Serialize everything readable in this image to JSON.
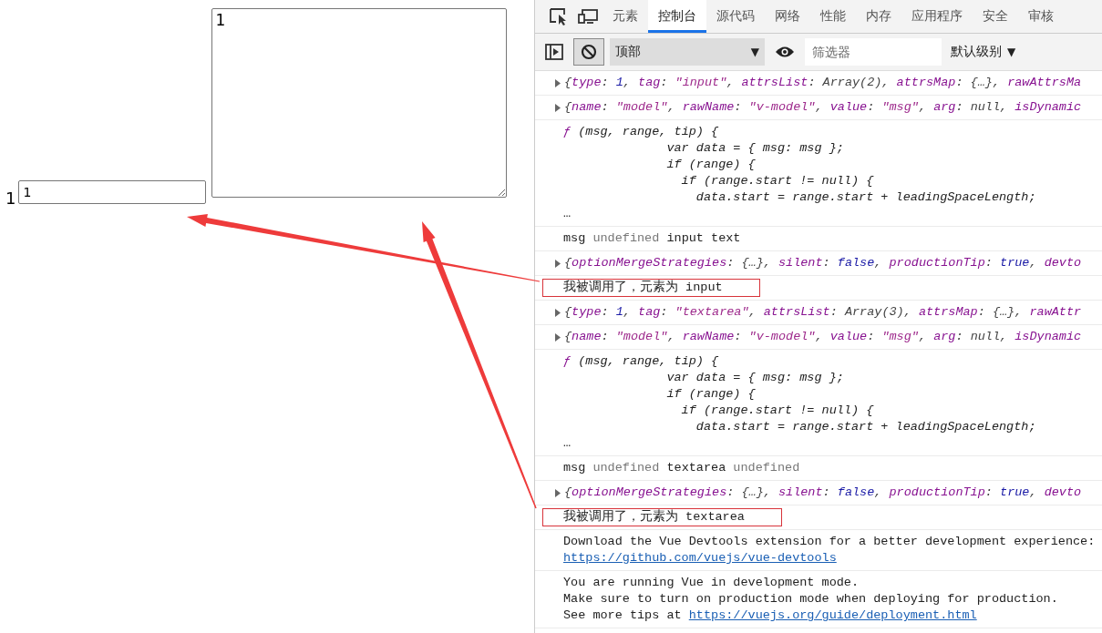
{
  "page": {
    "label": "1",
    "input_value": "1",
    "textarea_value": "1"
  },
  "devtools": {
    "tabs": [
      {
        "label": "元素",
        "selected": false
      },
      {
        "label": "控制台",
        "selected": true
      },
      {
        "label": "源代码",
        "selected": false
      },
      {
        "label": "网络",
        "selected": false
      },
      {
        "label": "性能",
        "selected": false
      },
      {
        "label": "内存",
        "selected": false
      },
      {
        "label": "应用程序",
        "selected": false
      },
      {
        "label": "安全",
        "selected": false
      },
      {
        "label": "审核",
        "selected": false
      }
    ],
    "toolbar": {
      "clear_pressed": true,
      "context": "顶部",
      "context_caret": "▼",
      "filter_placeholder": "筛选器",
      "levels": "默认级别",
      "levels_caret": "▼"
    },
    "messages": [
      {
        "kind": "object",
        "highlighted": false,
        "lines": [
          [
            {
              "kind": "punct",
              "text": "{"
            },
            {
              "kind": "key",
              "text": "type"
            },
            {
              "kind": "punct",
              "text": ": "
            },
            {
              "kind": "num",
              "text": "1"
            },
            {
              "kind": "punct",
              "text": ", "
            },
            {
              "kind": "key",
              "text": "tag"
            },
            {
              "kind": "punct",
              "text": ": "
            },
            {
              "kind": "str",
              "text": "\"input\""
            },
            {
              "kind": "punct",
              "text": ", "
            },
            {
              "kind": "key",
              "text": "attrsList"
            },
            {
              "kind": "punct",
              "text": ": "
            },
            {
              "kind": "gray",
              "text": "Array(2)"
            },
            {
              "kind": "punct",
              "text": ", "
            },
            {
              "kind": "key",
              "text": "attrsMap"
            },
            {
              "kind": "punct",
              "text": ": {…}, "
            },
            {
              "kind": "key",
              "text": "rawAttrsMa"
            }
          ]
        ]
      },
      {
        "kind": "object",
        "highlighted": false,
        "lines": [
          [
            {
              "kind": "punct",
              "text": "{"
            },
            {
              "kind": "key",
              "text": "name"
            },
            {
              "kind": "punct",
              "text": ": "
            },
            {
              "kind": "str",
              "text": "\"model\""
            },
            {
              "kind": "punct",
              "text": ", "
            },
            {
              "kind": "key",
              "text": "rawName"
            },
            {
              "kind": "punct",
              "text": ": "
            },
            {
              "kind": "str",
              "text": "\"v-model\""
            },
            {
              "kind": "punct",
              "text": ", "
            },
            {
              "kind": "key",
              "text": "value"
            },
            {
              "kind": "punct",
              "text": ": "
            },
            {
              "kind": "str",
              "text": "\"msg\""
            },
            {
              "kind": "punct",
              "text": ", "
            },
            {
              "kind": "key",
              "text": "arg"
            },
            {
              "kind": "punct",
              "text": ": "
            },
            {
              "kind": "gray",
              "text": "null"
            },
            {
              "kind": "punct",
              "text": ", "
            },
            {
              "kind": "key",
              "text": "isDynamic"
            }
          ]
        ]
      },
      {
        "kind": "function",
        "highlighted": false,
        "lines": [
          [
            {
              "kind": "fn",
              "text": "ƒ"
            },
            {
              "kind": "code",
              "text": " (msg, range, tip) {"
            }
          ],
          [
            {
              "kind": "code",
              "text": "              var data = { msg: msg };"
            }
          ],
          [
            {
              "kind": "code",
              "text": "              if (range) {"
            }
          ],
          [
            {
              "kind": "code",
              "text": "                if (range.start != null) {"
            }
          ],
          [
            {
              "kind": "code",
              "text": "                  data.start = range.start + leadingSpaceLength;"
            }
          ],
          [
            {
              "kind": "plain",
              "text": "…"
            }
          ]
        ]
      },
      {
        "kind": "log",
        "highlighted": false,
        "lines": [
          [
            {
              "kind": "plain",
              "text": "msg "
            },
            {
              "kind": "undef",
              "text": "undefined"
            },
            {
              "kind": "plain",
              "text": " input text"
            }
          ]
        ]
      },
      {
        "kind": "object",
        "highlighted": false,
        "lines": [
          [
            {
              "kind": "punct",
              "text": "{"
            },
            {
              "kind": "key",
              "text": "optionMergeStrategies"
            },
            {
              "kind": "punct",
              "text": ": {…}, "
            },
            {
              "kind": "key",
              "text": "silent"
            },
            {
              "kind": "punct",
              "text": ": "
            },
            {
              "kind": "num",
              "text": "false"
            },
            {
              "kind": "punct",
              "text": ", "
            },
            {
              "kind": "key",
              "text": "productionTip"
            },
            {
              "kind": "punct",
              "text": ": "
            },
            {
              "kind": "num",
              "text": "true"
            },
            {
              "kind": "punct",
              "text": ", "
            },
            {
              "kind": "key",
              "text": "devto"
            }
          ]
        ]
      },
      {
        "kind": "log",
        "highlighted": true,
        "lines": [
          [
            {
              "kind": "plain",
              "text": "我被调用了，元素为 input"
            }
          ]
        ]
      },
      {
        "kind": "object",
        "highlighted": false,
        "lines": [
          [
            {
              "kind": "punct",
              "text": "{"
            },
            {
              "kind": "key",
              "text": "type"
            },
            {
              "kind": "punct",
              "text": ": "
            },
            {
              "kind": "num",
              "text": "1"
            },
            {
              "kind": "punct",
              "text": ", "
            },
            {
              "kind": "key",
              "text": "tag"
            },
            {
              "kind": "punct",
              "text": ": "
            },
            {
              "kind": "str",
              "text": "\"textarea\""
            },
            {
              "kind": "punct",
              "text": ", "
            },
            {
              "kind": "key",
              "text": "attrsList"
            },
            {
              "kind": "punct",
              "text": ": "
            },
            {
              "kind": "gray",
              "text": "Array(3)"
            },
            {
              "kind": "punct",
              "text": ", "
            },
            {
              "kind": "key",
              "text": "attrsMap"
            },
            {
              "kind": "punct",
              "text": ": {…}, "
            },
            {
              "kind": "key",
              "text": "rawAttr"
            }
          ]
        ]
      },
      {
        "kind": "object",
        "highlighted": false,
        "lines": [
          [
            {
              "kind": "punct",
              "text": "{"
            },
            {
              "kind": "key",
              "text": "name"
            },
            {
              "kind": "punct",
              "text": ": "
            },
            {
              "kind": "str",
              "text": "\"model\""
            },
            {
              "kind": "punct",
              "text": ", "
            },
            {
              "kind": "key",
              "text": "rawName"
            },
            {
              "kind": "punct",
              "text": ": "
            },
            {
              "kind": "str",
              "text": "\"v-model\""
            },
            {
              "kind": "punct",
              "text": ", "
            },
            {
              "kind": "key",
              "text": "value"
            },
            {
              "kind": "punct",
              "text": ": "
            },
            {
              "kind": "str",
              "text": "\"msg\""
            },
            {
              "kind": "punct",
              "text": ", "
            },
            {
              "kind": "key",
              "text": "arg"
            },
            {
              "kind": "punct",
              "text": ": "
            },
            {
              "kind": "gray",
              "text": "null"
            },
            {
              "kind": "punct",
              "text": ", "
            },
            {
              "kind": "key",
              "text": "isDynamic"
            }
          ]
        ]
      },
      {
        "kind": "function",
        "highlighted": false,
        "lines": [
          [
            {
              "kind": "fn",
              "text": "ƒ"
            },
            {
              "kind": "code",
              "text": " (msg, range, tip) {"
            }
          ],
          [
            {
              "kind": "code",
              "text": "              var data = { msg: msg };"
            }
          ],
          [
            {
              "kind": "code",
              "text": "              if (range) {"
            }
          ],
          [
            {
              "kind": "code",
              "text": "                if (range.start != null) {"
            }
          ],
          [
            {
              "kind": "code",
              "text": "                  data.start = range.start + leadingSpaceLength;"
            }
          ],
          [
            {
              "kind": "plain",
              "text": "…"
            }
          ]
        ]
      },
      {
        "kind": "log",
        "highlighted": false,
        "lines": [
          [
            {
              "kind": "plain",
              "text": "msg "
            },
            {
              "kind": "undef",
              "text": "undefined"
            },
            {
              "kind": "plain",
              "text": " textarea "
            },
            {
              "kind": "undef",
              "text": "undefined"
            }
          ]
        ]
      },
      {
        "kind": "object",
        "highlighted": false,
        "lines": [
          [
            {
              "kind": "punct",
              "text": "{"
            },
            {
              "kind": "key",
              "text": "optionMergeStrategies"
            },
            {
              "kind": "punct",
              "text": ": {…}, "
            },
            {
              "kind": "key",
              "text": "silent"
            },
            {
              "kind": "punct",
              "text": ": "
            },
            {
              "kind": "num",
              "text": "false"
            },
            {
              "kind": "punct",
              "text": ", "
            },
            {
              "kind": "key",
              "text": "productionTip"
            },
            {
              "kind": "punct",
              "text": ": "
            },
            {
              "kind": "num",
              "text": "true"
            },
            {
              "kind": "punct",
              "text": ", "
            },
            {
              "kind": "key",
              "text": "devto"
            }
          ]
        ]
      },
      {
        "kind": "log",
        "highlighted": true,
        "lines": [
          [
            {
              "kind": "plain",
              "text": "我被调用了，元素为 textarea"
            }
          ]
        ]
      },
      {
        "kind": "log",
        "highlighted": false,
        "lines": [
          [
            {
              "kind": "plain",
              "text": "Download the Vue Devtools extension for a better development experience:"
            }
          ],
          [
            {
              "kind": "link",
              "text": "https://github.com/vuejs/vue-devtools"
            }
          ]
        ]
      },
      {
        "kind": "log",
        "highlighted": false,
        "lines": [
          [
            {
              "kind": "plain",
              "text": "You are running Vue in development mode."
            }
          ],
          [
            {
              "kind": "plain",
              "text": "Make sure to turn on production mode when deploying for production."
            }
          ],
          [
            {
              "kind": "plain",
              "text": "See more tips at "
            },
            {
              "kind": "link",
              "text": "https://vuejs.org/guide/deployment.html"
            }
          ]
        ]
      }
    ]
  }
}
